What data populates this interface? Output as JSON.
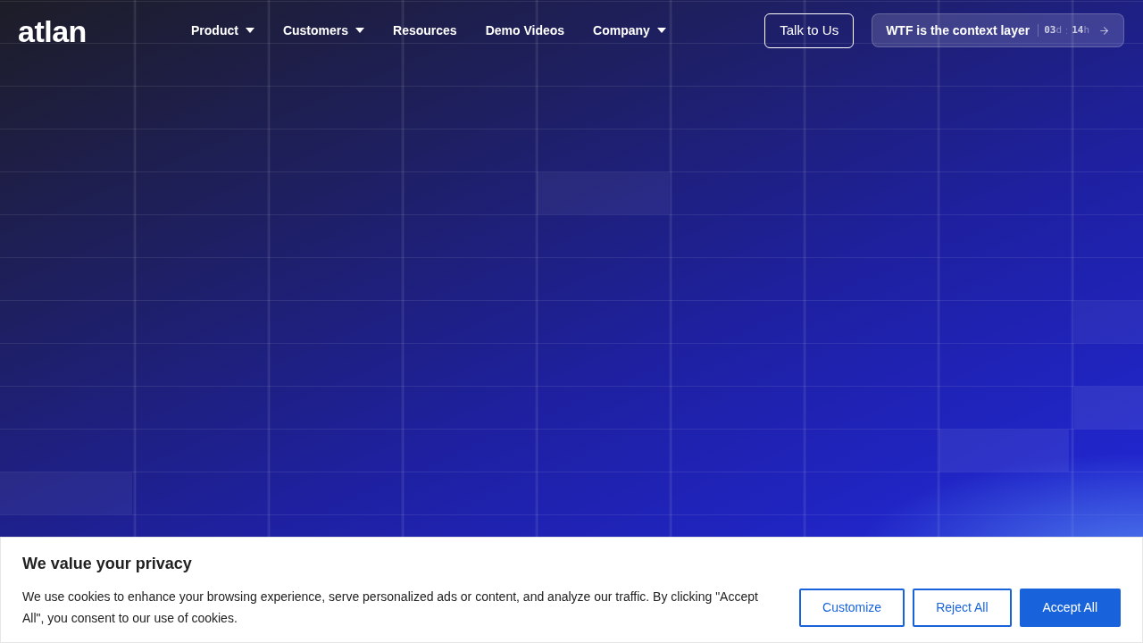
{
  "header": {
    "logo": "atlan",
    "nav": [
      {
        "label": "Product",
        "has_menu": true
      },
      {
        "label": "Customers",
        "has_menu": true
      },
      {
        "label": "Resources",
        "has_menu": false
      },
      {
        "label": "Demo Videos",
        "has_menu": false
      },
      {
        "label": "Company",
        "has_menu": true
      }
    ],
    "talk_button": "Talk to Us",
    "event_button": {
      "label": "WTF is the context layer",
      "countdown": [
        {
          "value": "03",
          "unit": "d"
        },
        {
          "value": "14",
          "unit": "h"
        }
      ],
      "separator": ":"
    }
  },
  "cookie_banner": {
    "title": "We value your privacy",
    "text": "We use cookies to enhance your browsing experience, serve personalized ads or content, and analyze our traffic. By clicking \"Accept All\", you consent to our use of cookies.",
    "buttons": [
      {
        "label": "Customize",
        "kind": "outline"
      },
      {
        "label": "Reject All",
        "kind": "outline"
      },
      {
        "label": "Accept All",
        "kind": "primary"
      }
    ]
  }
}
